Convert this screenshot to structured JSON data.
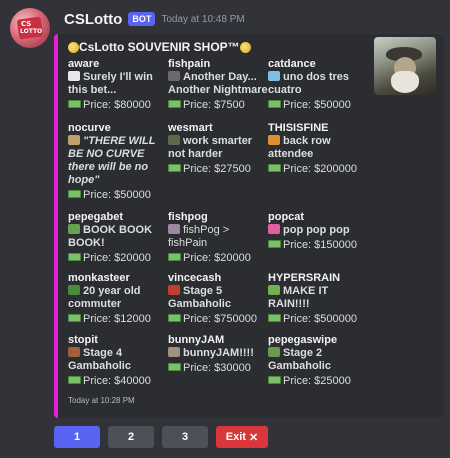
{
  "message": {
    "username": "CSLotto",
    "bot_tag": "BOT",
    "timestamp": "Today at 10:48 PM",
    "avatar_text_1": "CS",
    "avatar_text_2": "LOTTO"
  },
  "embed": {
    "accent_color": "#e91edc",
    "title": "CsLotto SOUVENIR SHOP™",
    "footer": "Today at 10:28 PM",
    "fields": [
      {
        "name": "aware",
        "value": "Surely I'll win this bet...",
        "price": "Price: $80000",
        "emoji_color": "#e8e8e8"
      },
      {
        "name": "fishpain",
        "value": "Another Day... Another Nightmare",
        "price": "Price: $7500",
        "emoji_color": "#6b6b6b"
      },
      {
        "name": "catdance",
        "value": "uno dos tres cuatro",
        "price": "Price: $50000",
        "emoji_color": "#7ec0e8"
      },
      {
        "name": "nocurve",
        "value": "\"THERE WILL BE NO CURVE there will be no hope\"",
        "price": "Price: $50000",
        "emoji_color": "#c0a070"
      },
      {
        "name": "wesmart",
        "value": "work smarter not harder",
        "price": "Price: $27500",
        "emoji_color": "#5a6a4a"
      },
      {
        "name": "THISISFINE",
        "value": "back row attendee",
        "price": "Price: $200000",
        "emoji_color": "#e09030"
      },
      {
        "name": "pepegabet",
        "value": "BOOK BOOK BOOK!",
        "price": "Price: $20000",
        "emoji_color": "#6aa050"
      },
      {
        "name": "fishpog",
        "value": "fishPog > fishPain",
        "price": "Price: $20000",
        "emoji_color": "#9a8aa0"
      },
      {
        "name": "popcat",
        "value": "pop pop pop",
        "price": "Price: $150000",
        "emoji_color": "#e060a0"
      },
      {
        "name": "monkasteer",
        "value": "20 year old commuter",
        "price": "Price: $12000",
        "emoji_color": "#4a8a3a"
      },
      {
        "name": "vincecash",
        "value": "Stage 5 Gambaholic",
        "price": "Price: $750000",
        "emoji_color": "#c04030"
      },
      {
        "name": "HYPERSRAIN",
        "value": "MAKE IT RAIN!!!!",
        "price": "Price: $500000",
        "emoji_color": "#70b050"
      },
      {
        "name": "stopit",
        "value": "Stage 4 Gambaholic",
        "price": "Price: $40000",
        "emoji_color": "#a06040"
      },
      {
        "name": "bunnyJAM",
        "value": "bunnyJAM!!!!",
        "price": "Price: $30000",
        "emoji_color": "#a09080"
      },
      {
        "name": "pepegaswipe",
        "value": "Stage 2 Gambaholic",
        "price": "Price: $25000",
        "emoji_color": "#6a9a50"
      }
    ]
  },
  "buttons": [
    {
      "label": "1",
      "style": "primary"
    },
    {
      "label": "2",
      "style": "secondary"
    },
    {
      "label": "3",
      "style": "secondary"
    },
    {
      "label": "Exit",
      "style": "danger",
      "icon": "x-icon"
    }
  ]
}
